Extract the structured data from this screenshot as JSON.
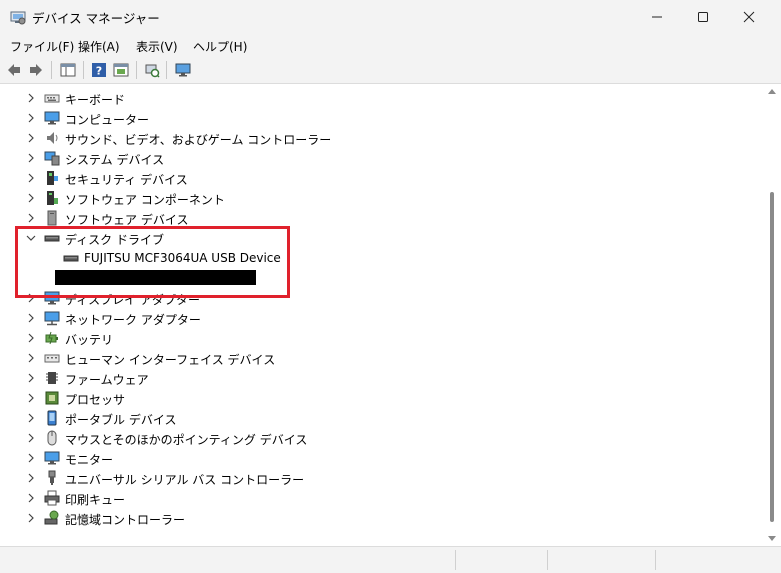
{
  "window": {
    "title": "デバイス マネージャー",
    "controls": [
      "minimize-icon",
      "maximize-icon",
      "close-icon"
    ]
  },
  "menu": [
    {
      "label": "ファイル(F)"
    },
    {
      "label": "操作(A)"
    },
    {
      "label": "表示(V)"
    },
    {
      "label": "ヘルプ(H)"
    }
  ],
  "toolbar": {
    "buttons": [
      "back-icon",
      "forward-icon",
      "properties-pane-icon",
      "help-icon",
      "show-hidden-icon",
      "scan-hardware-icon",
      "monitor-icon"
    ]
  },
  "tree": {
    "items": [
      {
        "label": "キーボード",
        "icon": "keyboard-icon",
        "expanded": false
      },
      {
        "label": "コンピューター",
        "icon": "computer-icon",
        "expanded": false
      },
      {
        "label": "サウンド、ビデオ、およびゲーム コントローラー",
        "icon": "speaker-icon",
        "expanded": false
      },
      {
        "label": "システム デバイス",
        "icon": "system-devices-icon",
        "expanded": false
      },
      {
        "label": "セキュリティ デバイス",
        "icon": "security-device-icon",
        "expanded": false
      },
      {
        "label": "ソフトウェア コンポーネント",
        "icon": "software-component-icon",
        "expanded": false
      },
      {
        "label": "ソフトウェア デバイス",
        "icon": "software-device-icon",
        "expanded": false
      },
      {
        "label": "ディスク ドライブ",
        "icon": "disk-drive-icon",
        "expanded": true,
        "children": [
          {
            "label": "FUJITSU MCF3064UA USB Device",
            "icon": "disk-drive-icon"
          }
        ]
      },
      {
        "label": "ディスプレイ アダプター",
        "icon": "display-adapter-icon",
        "expanded": false
      },
      {
        "label": "ネットワーク アダプター",
        "icon": "network-adapter-icon",
        "expanded": false
      },
      {
        "label": "バッテリ",
        "icon": "battery-icon",
        "expanded": false
      },
      {
        "label": "ヒューマン インターフェイス デバイス",
        "icon": "hid-icon",
        "expanded": false
      },
      {
        "label": "ファームウェア",
        "icon": "firmware-icon",
        "expanded": false
      },
      {
        "label": "プロセッサ",
        "icon": "processor-icon",
        "expanded": false
      },
      {
        "label": "ポータブル デバイス",
        "icon": "portable-device-icon",
        "expanded": false
      },
      {
        "label": "マウスとそのほかのポインティング デバイス",
        "icon": "mouse-icon",
        "expanded": false
      },
      {
        "label": "モニター",
        "icon": "monitor-icon",
        "expanded": false
      },
      {
        "label": "ユニバーサル シリアル バス コントローラー",
        "icon": "usb-icon",
        "expanded": false
      },
      {
        "label": "印刷キュー",
        "icon": "printer-icon",
        "expanded": false
      },
      {
        "label": "記憶域コントローラー",
        "icon": "storage-controller-icon",
        "expanded": false
      }
    ]
  },
  "colors": {
    "chrome": "#f3f3f3",
    "highlight_border": "#e0212c",
    "redaction": "#000000"
  }
}
